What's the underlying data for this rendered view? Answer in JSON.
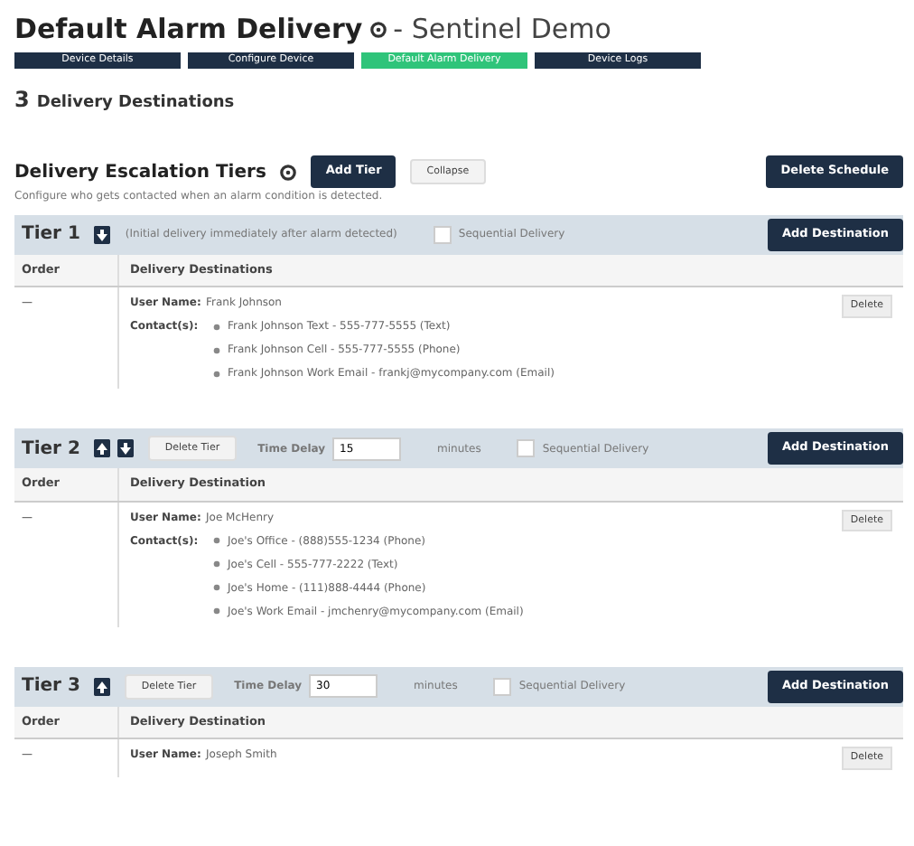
{
  "title": {
    "main": "Default Alarm Delivery",
    "sub": "- Sentinel Demo"
  },
  "nav": [
    {
      "label": "Device Details",
      "selected": false
    },
    {
      "label": "Configure Device",
      "selected": false
    },
    {
      "label": "Default Alarm Delivery",
      "selected": true
    },
    {
      "label": "Device Logs",
      "selected": false
    }
  ],
  "count": {
    "number": "3",
    "label": "Delivery Destinations"
  },
  "section": {
    "title": "Delivery Escalation Tiers",
    "add_button": "Add Tier",
    "collapse_button": "Collapse",
    "delete_button": "Delete Schedule",
    "subtitle": "Configure who gets contacted when an alarm condition is detected."
  },
  "tiers": [
    {
      "label": "Tier 1",
      "move_up": false,
      "move_down": true,
      "description": "(Initial delivery immediately after alarm detected)",
      "sequential_label": "Sequential Delivery",
      "sequential": false,
      "add_button": "Add Destination",
      "columns": [
        "Order",
        "Delivery Destinations"
      ],
      "destinations": [
        {
          "order": "—",
          "user_label": "User Name:",
          "user": "Frank Johnson",
          "contacts_label": "Contact(s):",
          "contacts": [
            "Frank Johnson Text - 555-777-5555 (Text)",
            "Frank Johnson Cell - 555-777-5555 (Phone)",
            "Frank Johnson Work Email - frankj@mycompany.com (Email)"
          ],
          "delete": "Delete"
        }
      ]
    },
    {
      "label": "Tier 2",
      "move_up": true,
      "move_down": true,
      "delete_tier": "Delete Tier",
      "delay_label": "Time Delay",
      "delay": "15",
      "unit": "minutes",
      "sequential_label": "Sequential Delivery",
      "sequential": false,
      "add_button": "Add Destination",
      "columns": [
        "Order",
        "Delivery Destination"
      ],
      "destinations": [
        {
          "order": "—",
          "user_label": "User Name:",
          "user": "Joe McHenry",
          "contacts_label": "Contact(s):",
          "contacts": [
            "Joe's Office - (888)555-1234 (Phone)",
            "Joe's Cell - 555-777-2222 (Text)",
            "Joe's Home - (111)888-4444 (Phone)",
            "Joe's Work Email - jmchenry@mycompany.com (Email)"
          ],
          "delete": "Delete"
        }
      ]
    },
    {
      "label": "Tier 3",
      "move_up": true,
      "move_down": false,
      "delete_tier": "Delete Tier",
      "delay_label": "Time Delay",
      "delay": "30",
      "unit": "minutes",
      "sequential_label": "Sequential Delivery",
      "sequential": false,
      "add_button": "Add Destination",
      "columns": [
        "Order",
        "Delivery Destination"
      ],
      "destinations": [
        {
          "order": "—",
          "user_label": "User Name:",
          "user": "Joseph Smith",
          "delete": "Delete"
        }
      ]
    }
  ]
}
